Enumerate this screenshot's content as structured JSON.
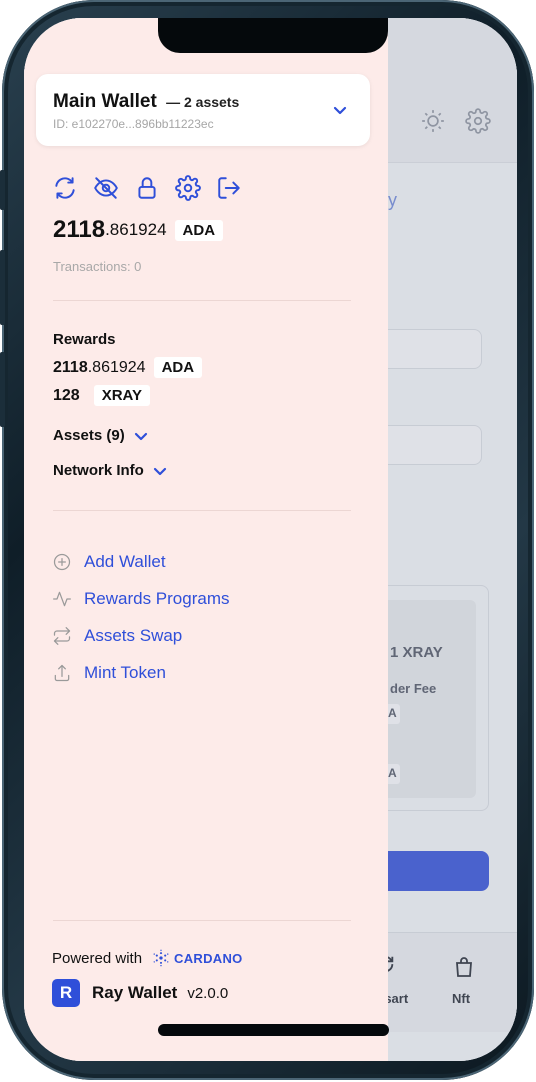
{
  "wallet": {
    "name": "Main Wallet",
    "assets_label": "— 2 assets",
    "id": "ID: e102270e...896bb11223ec"
  },
  "balance": {
    "integer": "2118",
    "decimal": ".861924",
    "currency": "ADA",
    "transactions": "Transactions: 0"
  },
  "rewards": {
    "title": "Rewards",
    "items": [
      {
        "integer": "2118",
        "decimal": ".861924",
        "currency": "ADA"
      },
      {
        "integer": "128",
        "decimal": "",
        "currency": "XRAY"
      }
    ]
  },
  "sections": {
    "assets": "Assets (9)",
    "network": "Network Info"
  },
  "menu": [
    {
      "label": "Add Wallet",
      "icon": "plus-circle-icon"
    },
    {
      "label": "Rewards Programs",
      "icon": "activity-icon"
    },
    {
      "label": "Assets Swap",
      "icon": "swap-icon"
    },
    {
      "label": "Mint Token",
      "icon": "upload-icon"
    }
  ],
  "footer": {
    "powered_with": "Powered with",
    "cardano": "CARDANO",
    "app_name": "Ray Wallet",
    "version": "v2.0.0"
  },
  "background_app": {
    "link_fragment": "y",
    "card_line1": "1 XRAY",
    "card_line2": "der Fee",
    "chip1": "A",
    "chip2": "A",
    "tab1": "tsart",
    "tab2": "Nft"
  },
  "colors": {
    "accent": "#2f4fd9",
    "drawer_bg": "#fdebe9"
  }
}
